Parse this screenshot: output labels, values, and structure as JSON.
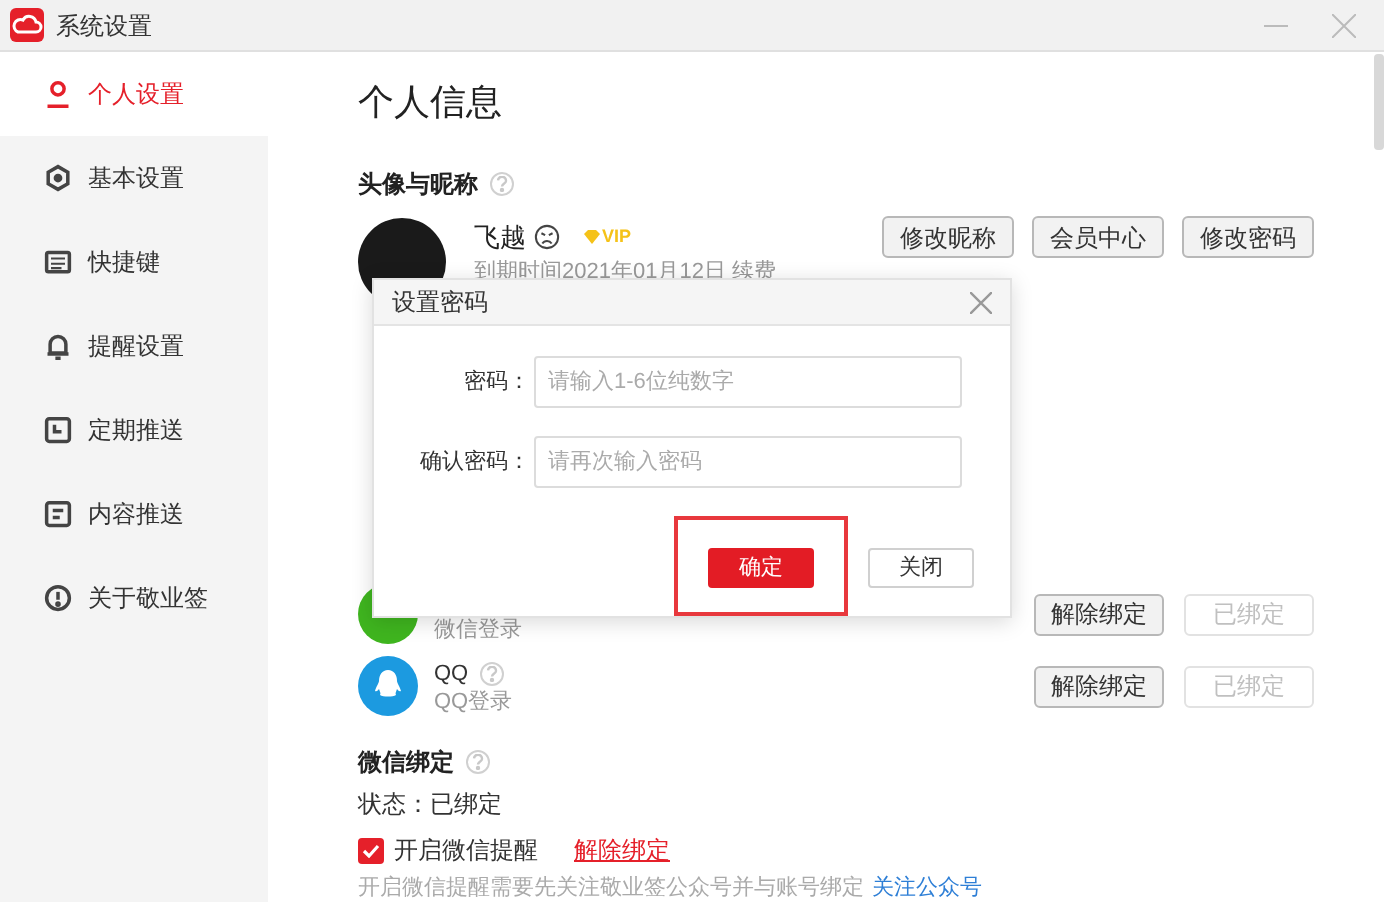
{
  "window": {
    "title": "系统设置"
  },
  "sidebar": {
    "items": [
      {
        "label": "个人设置",
        "selected": true
      },
      {
        "label": "基本设置",
        "selected": false
      },
      {
        "label": "快捷键",
        "selected": false
      },
      {
        "label": "提醒设置",
        "selected": false
      },
      {
        "label": "定期推送",
        "selected": false
      },
      {
        "label": "内容推送",
        "selected": false
      },
      {
        "label": "关于敬业签",
        "selected": false
      }
    ]
  },
  "page_title": "个人信息",
  "profile": {
    "heading": "头像与昵称",
    "name": "飞越",
    "vip_badge": "VIP",
    "expiry": "到期时间2021年01月12日 续费",
    "buttons": [
      "修改昵称",
      "会员中心",
      "修改密码"
    ]
  },
  "bindings": [
    {
      "kind": "wechat",
      "subtitle": "微信登录",
      "buttons": [
        {
          "label": "解除绑定",
          "disabled": false
        },
        {
          "label": "已绑定",
          "disabled": true
        }
      ]
    },
    {
      "kind": "qq",
      "name": "QQ",
      "subtitle": "QQ登录",
      "buttons": [
        {
          "label": "解除绑定",
          "disabled": false
        },
        {
          "label": "已绑定",
          "disabled": true
        }
      ]
    }
  ],
  "wechat_binding": {
    "heading": "微信绑定",
    "status": "状态：已绑定",
    "reminder": {
      "label": "开启微信提醒",
      "checked": true
    },
    "unbind_link": "解除绑定",
    "note": "开启微信提醒需要先关注敬业签公众号并与账号绑定",
    "note_link": "关注公众号"
  },
  "dialog": {
    "title": "设置密码",
    "fields": [
      {
        "label": "密码：",
        "placeholder": "请输入1-6位纯数字"
      },
      {
        "label": "确认密码：",
        "placeholder": "请再次输入密码"
      }
    ],
    "buttons": [
      {
        "label": "确定",
        "primary": true,
        "highlighted": true
      },
      {
        "label": "关闭",
        "primary": false,
        "highlighted": false
      }
    ]
  }
}
